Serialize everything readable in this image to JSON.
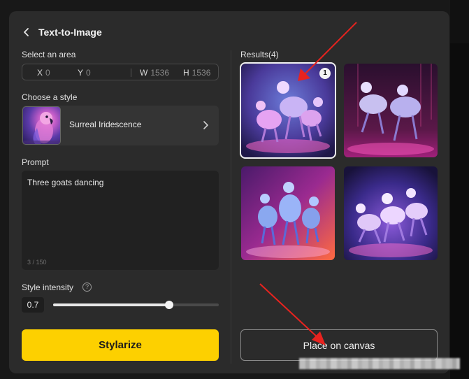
{
  "panel": {
    "title": "Text-to-Image"
  },
  "area": {
    "label": "Select an area",
    "x_key": "X",
    "x_value": "0",
    "y_key": "Y",
    "y_value": "0",
    "w_key": "W",
    "w_value": "1536",
    "h_key": "H",
    "h_value": "1536"
  },
  "style": {
    "label": "Choose a style",
    "selected": "Surreal Iridescence"
  },
  "prompt": {
    "label": "Prompt",
    "text": "Three goats dancing",
    "count": "3 / 150"
  },
  "intensity": {
    "label": "Style intensity",
    "help": "?",
    "value": "0.7",
    "level": 0.7
  },
  "actions": {
    "stylize_label": "Stylarize",
    "place_label": "Place on canvas"
  },
  "results": {
    "label": "Results(4)",
    "selected_badge": "1"
  },
  "colors": {
    "accent": "#fdd000",
    "panel_bg": "#2b2b2b",
    "annotation": "#e8231f"
  }
}
